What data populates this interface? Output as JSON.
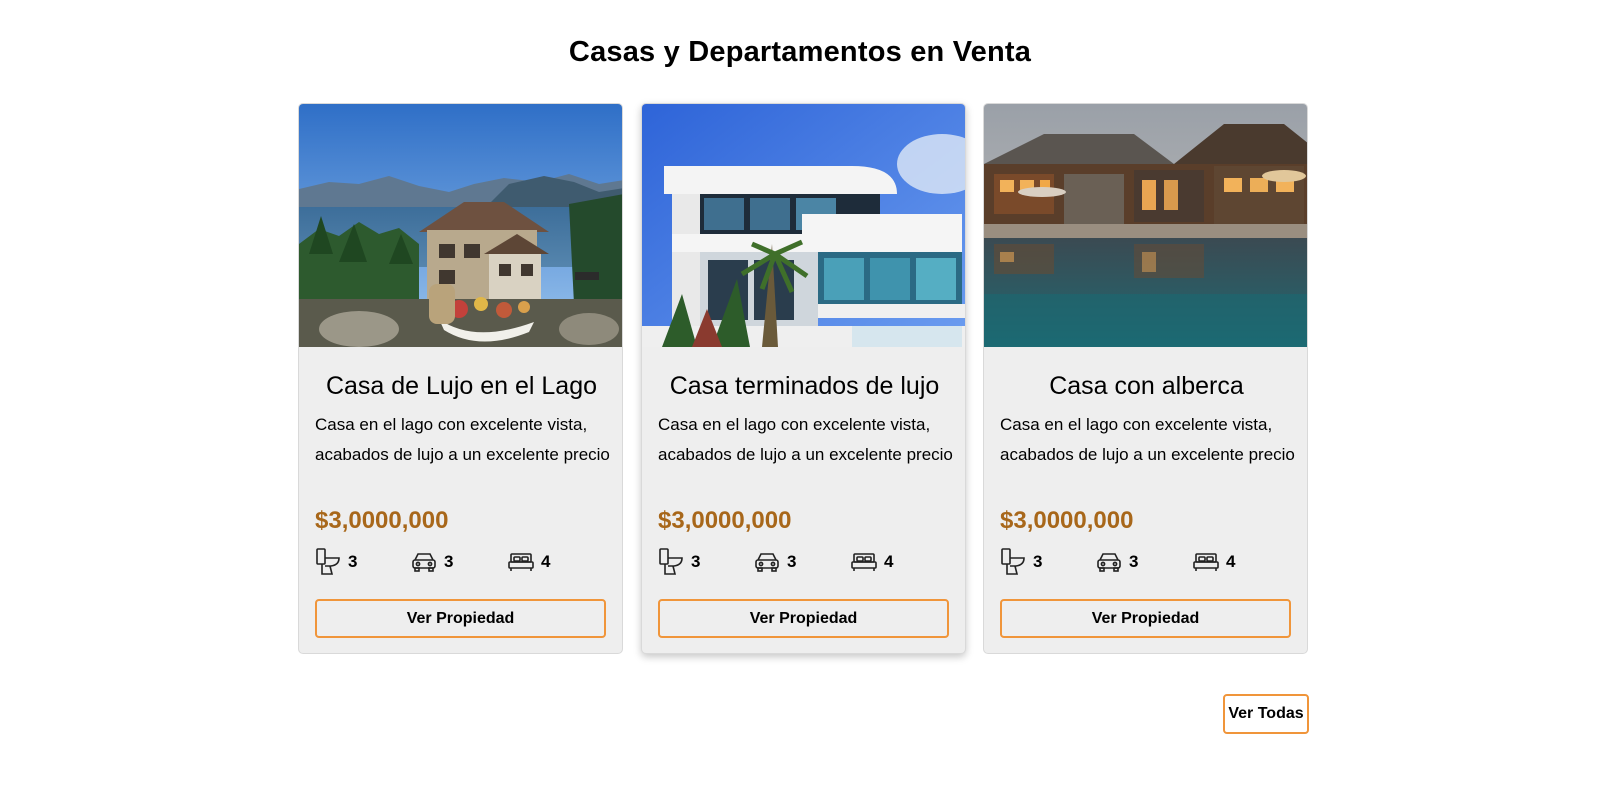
{
  "section": {
    "title": "Casas y Departamentos en Venta"
  },
  "properties": [
    {
      "image": "lake-house-photo",
      "title": "Casa de Lujo en el Lago",
      "description": "Casa en el lago con excelente vista, acabados de lujo a un excelente precio",
      "price": "$3,0000,000",
      "features": [
        {
          "icon": "toilet-icon",
          "value": "3"
        },
        {
          "icon": "car-icon",
          "value": "3"
        },
        {
          "icon": "bed-icon",
          "value": "4"
        }
      ],
      "button_label": "Ver Propiedad"
    },
    {
      "image": "modern-house-photo",
      "title": "Casa terminados de lujo",
      "description": "Casa en el lago con excelente vista, acabados de lujo a un excelente precio",
      "price": "$3,0000,000",
      "features": [
        {
          "icon": "toilet-icon",
          "value": "3"
        },
        {
          "icon": "car-icon",
          "value": "3"
        },
        {
          "icon": "bed-icon",
          "value": "4"
        }
      ],
      "button_label": "Ver Propiedad"
    },
    {
      "image": "pool-house-photo",
      "title": "Casa con alberca",
      "description": "Casa en el lago con excelente vista, acabados de lujo a un excelente precio",
      "price": "$3,0000,000",
      "features": [
        {
          "icon": "toilet-icon",
          "value": "3"
        },
        {
          "icon": "car-icon",
          "value": "3"
        },
        {
          "icon": "bed-icon",
          "value": "4"
        }
      ],
      "button_label": "Ver Propiedad"
    }
  ],
  "view_all_label": "Ver Todas",
  "colors": {
    "price": "#a8671a",
    "button_border": "#f0953a",
    "card_bg": "#eeeeee"
  }
}
